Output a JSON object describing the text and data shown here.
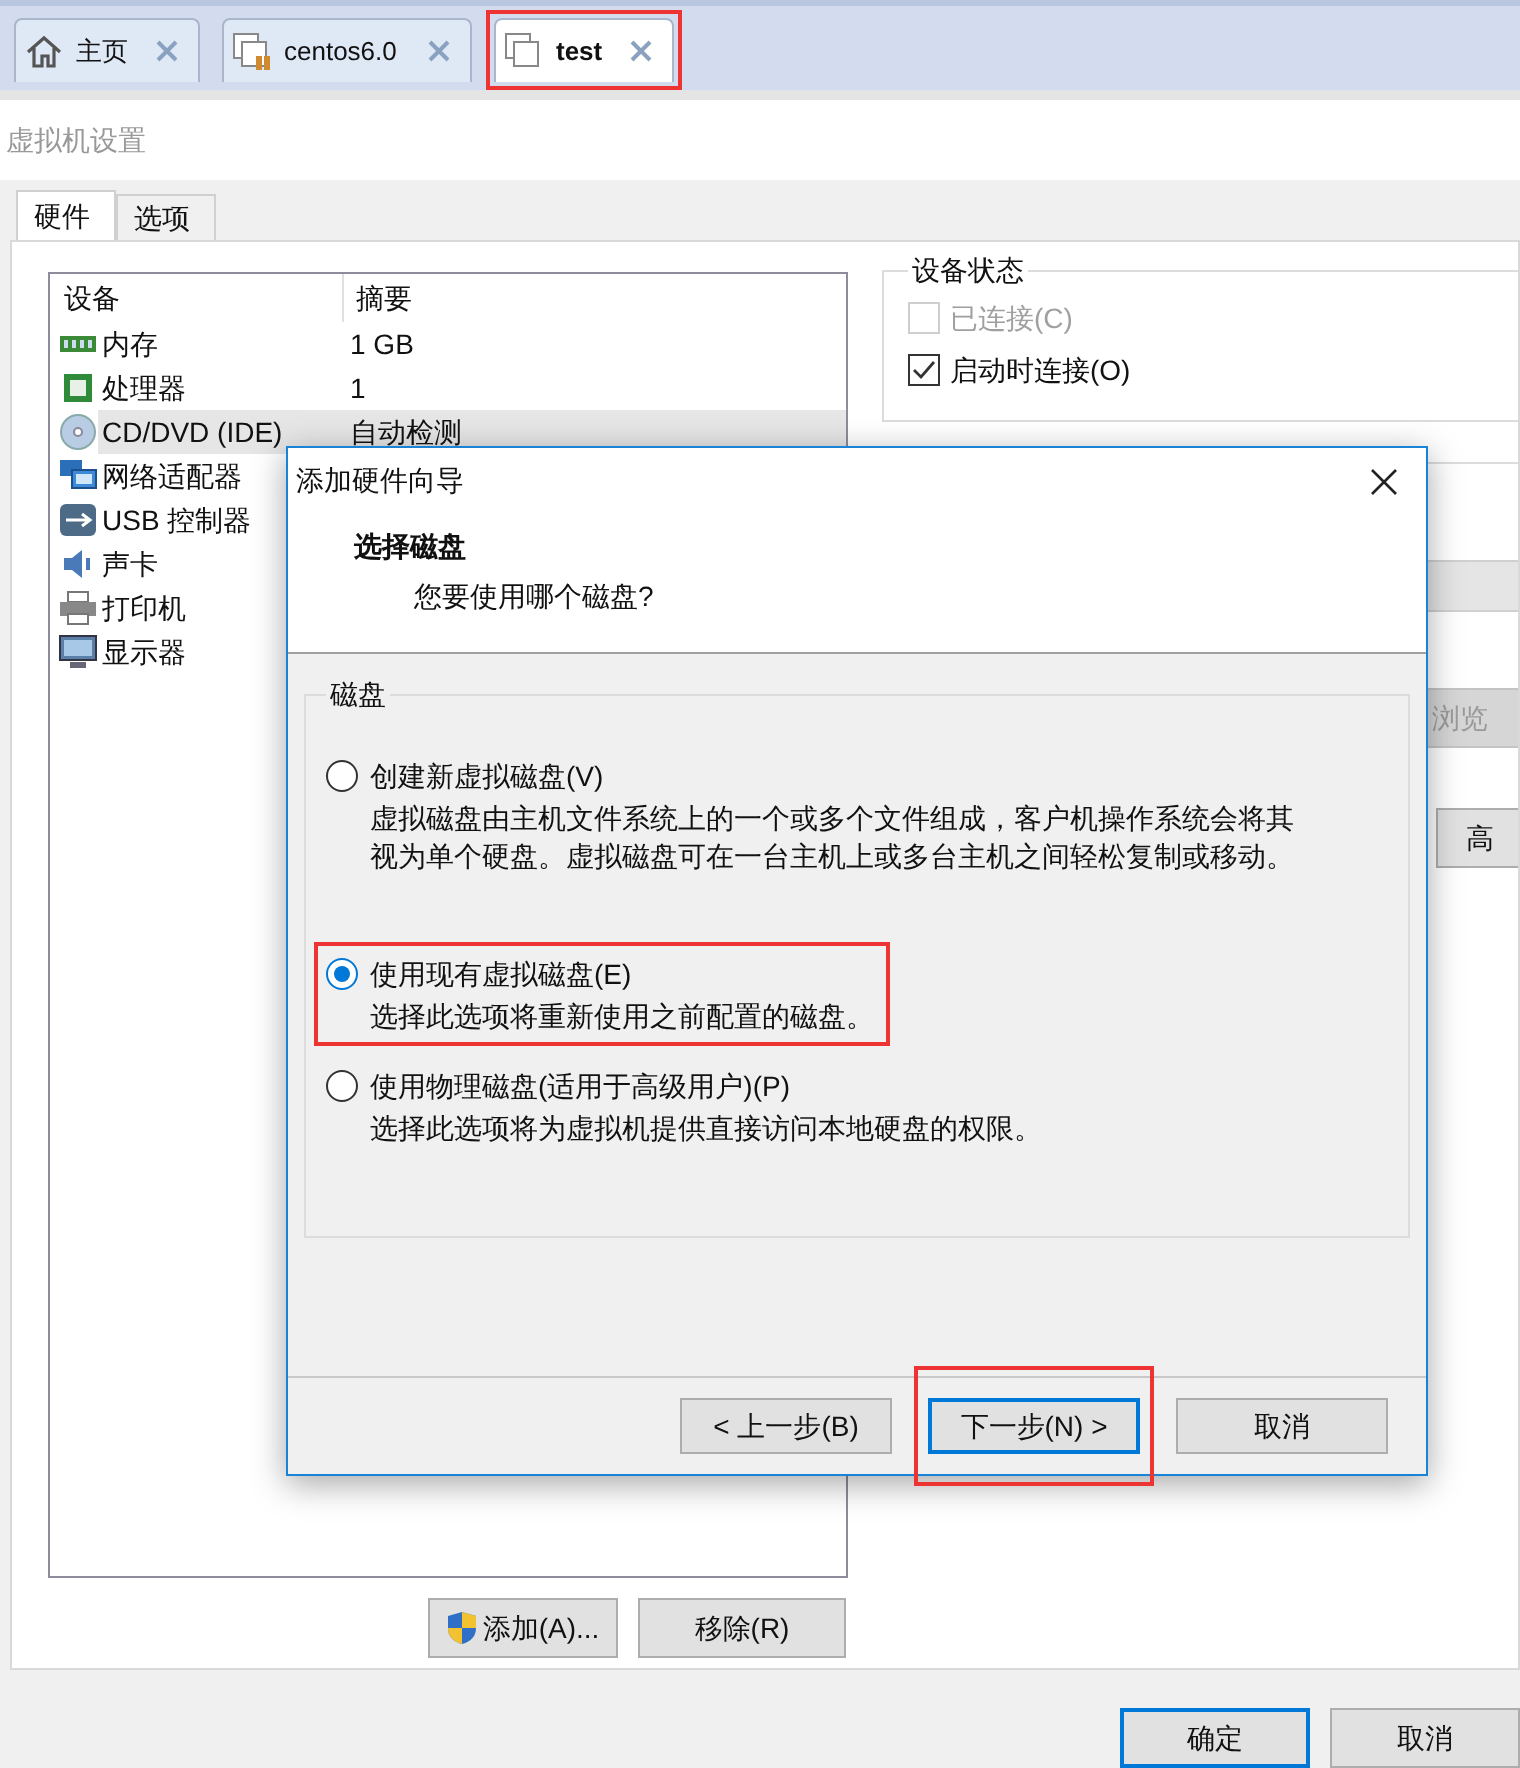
{
  "tabs": [
    {
      "label": "主页",
      "kind": "home",
      "selected": false,
      "highlighted": false
    },
    {
      "label": "centos6.0",
      "kind": "vm-running",
      "selected": false,
      "highlighted": false
    },
    {
      "label": "test",
      "kind": "vm",
      "selected": true,
      "highlighted": true
    }
  ],
  "settings": {
    "title": "虚拟机设置",
    "tabs": [
      {
        "label": "硬件",
        "selected": true
      },
      {
        "label": "选项",
        "selected": false
      }
    ],
    "device_table": {
      "columns": [
        "设备",
        "摘要"
      ],
      "rows": [
        {
          "kind": "memory",
          "device": "内存",
          "summary": "1 GB",
          "selected": false
        },
        {
          "kind": "cpu",
          "device": "处理器",
          "summary": "1",
          "selected": false
        },
        {
          "kind": "cd",
          "device": "CD/DVD (IDE)",
          "summary": "自动检测",
          "selected": true
        },
        {
          "kind": "network",
          "device": "网络适配器",
          "selected": false
        },
        {
          "kind": "usb",
          "device": "USB 控制器",
          "selected": false
        },
        {
          "kind": "sound",
          "device": "声卡",
          "selected": false
        },
        {
          "kind": "printer",
          "device": "打印机",
          "selected": false
        },
        {
          "kind": "display",
          "device": "显示器",
          "selected": false
        }
      ]
    },
    "device_status": {
      "title": "设备状态",
      "checkboxes": [
        {
          "label": "已连接(C)",
          "checked": false,
          "disabled": true
        },
        {
          "label": "启动时连接(O)",
          "checked": true,
          "disabled": false
        }
      ]
    },
    "side_buttons": [
      {
        "label": "浏览",
        "disabled": true
      },
      {
        "label": "高",
        "disabled": false
      }
    ],
    "list_buttons": [
      {
        "label": "添加(A)...",
        "kind": "shield"
      },
      {
        "label": "移除(R)",
        "kind": "plain"
      }
    ],
    "footer_buttons": [
      {
        "label": "确定",
        "default": true
      },
      {
        "label": "取消",
        "default": false
      }
    ]
  },
  "dialog": {
    "title": "添加硬件向导",
    "heading": "选择磁盘",
    "subheading": "您要使用哪个磁盘?",
    "group": "磁盘",
    "options": [
      {
        "label": "创建新虚拟磁盘(V)",
        "description": "虚拟磁盘由主机文件系统上的一个或多个文件组成，客户机操作系统会将其视为单个硬盘。虚拟磁盘可在一台主机上或多台主机之间轻松复制或移动。",
        "selected": false,
        "highlighted": false
      },
      {
        "label": "使用现有虚拟磁盘(E)",
        "description": "选择此选项将重新使用之前配置的磁盘。",
        "selected": true,
        "highlighted": true
      },
      {
        "label": "使用物理磁盘(适用于高级用户)(P)",
        "description": "选择此选项将为虚拟机提供直接访问本地硬盘的权限。",
        "selected": false,
        "highlighted": false
      }
    ],
    "buttons": [
      {
        "label": "< 上一步(B)",
        "default": false,
        "highlighted": false
      },
      {
        "label": "下一步(N) >",
        "default": true,
        "highlighted": true
      },
      {
        "label": "取消",
        "default": false,
        "highlighted": false
      }
    ]
  }
}
